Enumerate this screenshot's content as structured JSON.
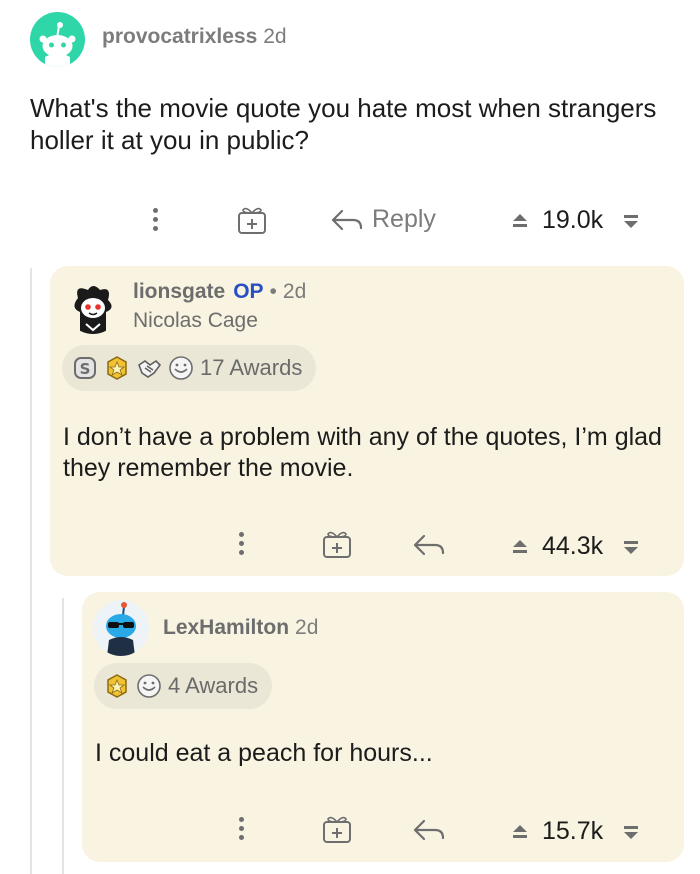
{
  "post": {
    "username": "provocatrixless",
    "time": "2d",
    "body": "What's the movie quote you hate most when strangers holler it at you in public?",
    "reply_label": "Reply",
    "score": "19.0k",
    "avatar_color": "#2fd6a8"
  },
  "reply1": {
    "username": "lionsgate",
    "op_label": "OP",
    "dot": "•",
    "time": "2d",
    "flair": "Nicolas Cage",
    "awards_label": "17 Awards",
    "body": "I don’t have a problem with any of the quotes, I’m glad they remember the movie.",
    "score": "44.3k"
  },
  "reply2": {
    "username": "LexHamilton",
    "time": "2d",
    "awards_label": "4 Awards",
    "body": "I could eat a peach for hours...",
    "score": "15.7k"
  },
  "colors": {
    "card_bg": "#f8f4e1",
    "op_blue": "#2a4fc4",
    "muted": "#7c7c7c"
  }
}
